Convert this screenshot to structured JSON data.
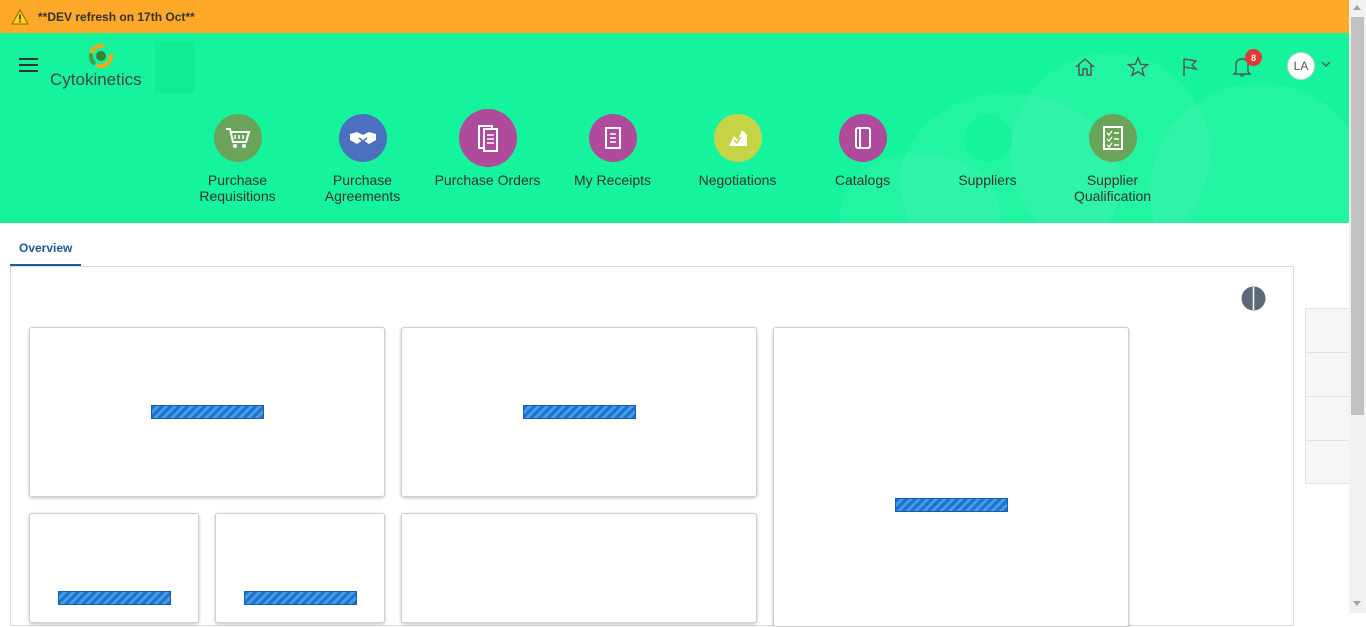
{
  "banner": {
    "text": "**DEV refresh on 17th Oct**",
    "icon": "warning-icon"
  },
  "header": {
    "brand": "Cytokinetics",
    "notifications_count": "8",
    "avatar_initials": "LA",
    "icons": [
      "home-icon",
      "favorites-star-icon",
      "flag-icon",
      "notifications-bell-icon"
    ]
  },
  "nav": [
    {
      "label": "Purchase Requisitions",
      "icon": "shopping-cart-icon",
      "color": "#6aa35a"
    },
    {
      "label": "Purchase Agreements",
      "icon": "handshake-icon",
      "color": "#4c6fc0"
    },
    {
      "label": "Purchase Orders",
      "icon": "document-stack-icon",
      "color": "#b04a9b"
    },
    {
      "label": "My Receipts",
      "icon": "receipt-icon",
      "color": "#b04a9b"
    },
    {
      "label": "Negotiations",
      "icon": "negotiation-icon",
      "color": "#c6d344"
    },
    {
      "label": "Catalogs",
      "icon": "catalog-book-icon",
      "color": "#b04a9b"
    },
    {
      "label": "Suppliers",
      "icon": "suppliers-icon",
      "color": "#15f49d"
    },
    {
      "label": "Supplier Qualification",
      "icon": "checklist-icon",
      "color": "#6aa35a"
    }
  ],
  "tabs": [
    {
      "label": "Overview",
      "active": true
    }
  ],
  "colors": {
    "banner": "#fea929",
    "header": "#15f49d",
    "tab_accent": "#1a5c94",
    "loader": "#1e73cf"
  }
}
